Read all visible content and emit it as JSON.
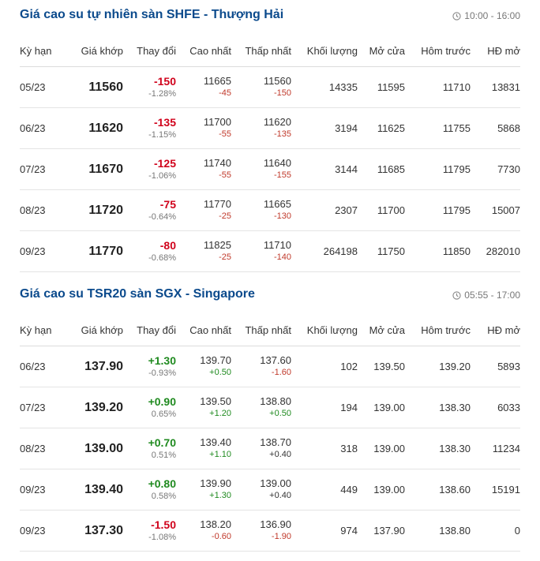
{
  "columns": [
    "Kỳ hạn",
    "Giá khớp",
    "Thay đổi",
    "Cao nhất",
    "Thấp nhất",
    "Khối lượng",
    "Mở cửa",
    "Hôm trước",
    "HĐ mở"
  ],
  "colors": {
    "title": "#0b4a8c",
    "negative": "#d0021b",
    "positive": "#1f8a1f"
  },
  "icons": {
    "time": "clock-icon"
  },
  "shfe": {
    "title": "Giá cao su tự nhiên sàn SHFE - Thượng Hải",
    "time": "10:00 - 16:00",
    "rows": [
      {
        "term": "05/23",
        "price": "11560",
        "change": "-150",
        "change_pct": "-1.28%",
        "dir": "neg",
        "high": "11665",
        "high_chg": "-45",
        "high_dir": "neg",
        "low": "11560",
        "low_chg": "-150",
        "low_dir": "neg",
        "volume": "14335",
        "open": "11595",
        "prev": "11710",
        "oi": "13831"
      },
      {
        "term": "06/23",
        "price": "11620",
        "change": "-135",
        "change_pct": "-1.15%",
        "dir": "neg",
        "high": "11700",
        "high_chg": "-55",
        "high_dir": "neg",
        "low": "11620",
        "low_chg": "-135",
        "low_dir": "neg",
        "volume": "3194",
        "open": "11625",
        "prev": "11755",
        "oi": "5868"
      },
      {
        "term": "07/23",
        "price": "11670",
        "change": "-125",
        "change_pct": "-1.06%",
        "dir": "neg",
        "high": "11740",
        "high_chg": "-55",
        "high_dir": "neg",
        "low": "11640",
        "low_chg": "-155",
        "low_dir": "neg",
        "volume": "3144",
        "open": "11685",
        "prev": "11795",
        "oi": "7730"
      },
      {
        "term": "08/23",
        "price": "11720",
        "change": "-75",
        "change_pct": "-0.64%",
        "dir": "neg",
        "high": "11770",
        "high_chg": "-25",
        "high_dir": "neg",
        "low": "11665",
        "low_chg": "-130",
        "low_dir": "neg",
        "volume": "2307",
        "open": "11700",
        "prev": "11795",
        "oi": "15007"
      },
      {
        "term": "09/23",
        "price": "11770",
        "change": "-80",
        "change_pct": "-0.68%",
        "dir": "neg",
        "high": "11825",
        "high_chg": "-25",
        "high_dir": "neg",
        "low": "11710",
        "low_chg": "-140",
        "low_dir": "neg",
        "volume": "264198",
        "open": "11750",
        "prev": "11850",
        "oi": "282010"
      }
    ]
  },
  "sgx": {
    "title": "Giá cao su TSR20 sàn SGX - Singapore",
    "time": "05:55 - 17:00",
    "rows": [
      {
        "term": "06/23",
        "price": "137.90",
        "change": "+1.30",
        "change_pct": "-0.93%",
        "dir": "pos",
        "high": "139.70",
        "high_chg": "+0.50",
        "high_dir": "pos",
        "low": "137.60",
        "low_chg": "-1.60",
        "low_dir": "neg",
        "volume": "102",
        "open": "139.50",
        "prev": "139.20",
        "oi": "5893"
      },
      {
        "term": "07/23",
        "price": "139.20",
        "change": "+0.90",
        "change_pct": "0.65%",
        "dir": "pos",
        "high": "139.50",
        "high_chg": "+1.20",
        "high_dir": "pos",
        "low": "138.80",
        "low_chg": "+0.50",
        "low_dir": "pos",
        "volume": "194",
        "open": "139.00",
        "prev": "138.30",
        "oi": "6033"
      },
      {
        "term": "08/23",
        "price": "139.00",
        "change": "+0.70",
        "change_pct": "0.51%",
        "dir": "pos",
        "high": "139.40",
        "high_chg": "+1.10",
        "high_dir": "pos",
        "low": "138.70",
        "low_chg": "+0.40",
        "low_dir": "plain",
        "volume": "318",
        "open": "139.00",
        "prev": "138.30",
        "oi": "11234"
      },
      {
        "term": "09/23",
        "price": "139.40",
        "change": "+0.80",
        "change_pct": "0.58%",
        "dir": "pos",
        "high": "139.90",
        "high_chg": "+1.30",
        "high_dir": "pos",
        "low": "139.00",
        "low_chg": "+0.40",
        "low_dir": "plain",
        "volume": "449",
        "open": "139.00",
        "prev": "138.60",
        "oi": "15191"
      },
      {
        "term": "09/23",
        "price": "137.30",
        "change": "-1.50",
        "change_pct": "-1.08%",
        "dir": "neg",
        "high": "138.20",
        "high_chg": "-0.60",
        "high_dir": "neg",
        "low": "136.90",
        "low_chg": "-1.90",
        "low_dir": "neg",
        "volume": "974",
        "open": "137.90",
        "prev": "138.80",
        "oi": "0"
      }
    ]
  }
}
